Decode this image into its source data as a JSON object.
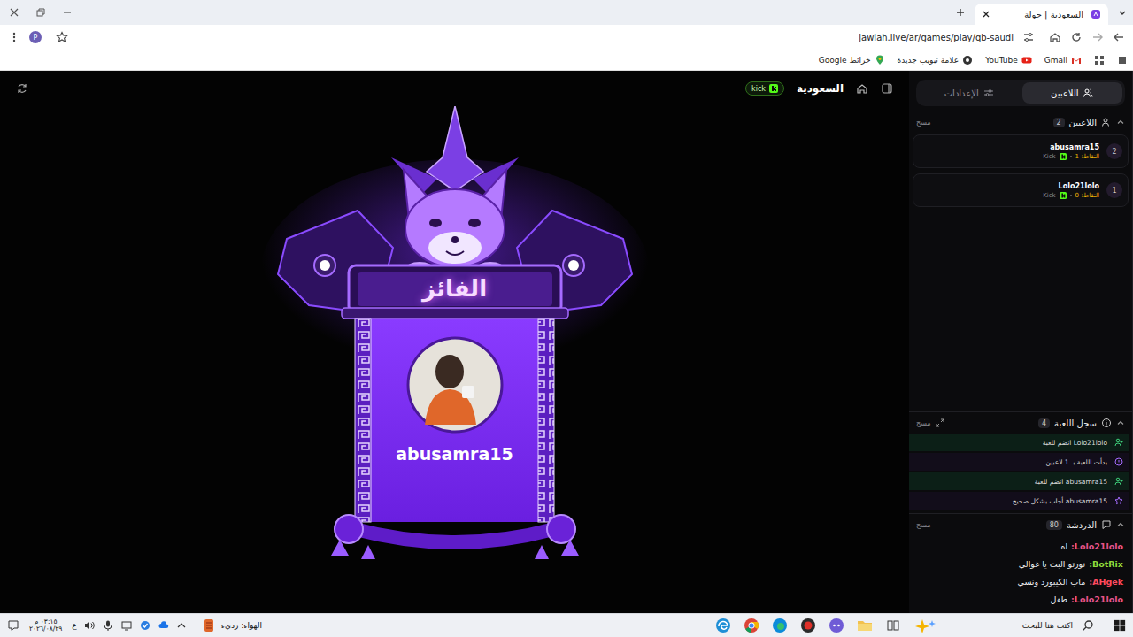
{
  "browser": {
    "tab": {
      "title": "السعودية | جولة",
      "selected": true
    },
    "url": "jawlah.live/ar/games/play/qb-saudi",
    "profile": "P",
    "bookmarks": [
      {
        "label": "Gmail",
        "kind": "gmail"
      },
      {
        "label": "YouTube",
        "kind": "youtube"
      },
      {
        "label": "علامة تبويب جديدة",
        "kind": "newtab"
      },
      {
        "label": "خرائط Google",
        "kind": "maps"
      }
    ]
  },
  "game": {
    "title": "السعودية",
    "platform_badge": "kick",
    "winner_title": "الفائز",
    "winner_name": "abusamra15"
  },
  "sidebar": {
    "tabs": [
      {
        "label": "اللاعبين",
        "selected": true
      },
      {
        "label": "الإعدادات",
        "selected": false
      }
    ],
    "players": {
      "title": "اللاعبين",
      "count": "2",
      "clear": "مسح",
      "items": [
        {
          "rank": "2",
          "name": "abusamra15",
          "platform": "Kick",
          "points": "النقاط: 1"
        },
        {
          "rank": "1",
          "name": "Lolo21lolo",
          "platform": "Kick",
          "points": "النقاط: 0"
        }
      ]
    },
    "log": {
      "title": "سجل اللعبة",
      "count": "4",
      "clear": "مسح",
      "items": [
        {
          "kind": "join",
          "text": "Lolo21lolo انضم للعبة"
        },
        {
          "kind": "start",
          "text": "بدأت اللعبة بـ 1 لاعبين"
        },
        {
          "kind": "join",
          "text": "abusamra15 انضم للعبة"
        },
        {
          "kind": "correct",
          "text": "abusamra15 أجاب بشكل صحيح"
        }
      ]
    },
    "chat": {
      "title": "الدردشة",
      "count": "80",
      "clear": "مسح",
      "messages": [
        {
          "user": "Lolo21lolo:",
          "text": "اه",
          "color": "#e8548a"
        },
        {
          "user": "BotRix:",
          "text": "نورتو البث يا غوالي",
          "color": "#8fdc3a"
        },
        {
          "user": "AHgek:",
          "text": "ماب الكيبورد ونسي",
          "color": "#ff4a5e"
        },
        {
          "user": "Lolo21lolo:",
          "text": "طفل",
          "color": "#e8548a"
        }
      ]
    }
  },
  "taskbar": {
    "search_placeholder": "اكتب هنا للبحث",
    "weather": "الهواء: رديء",
    "language": "ع",
    "time": "٠٣:١٥ م",
    "date": "٢٠٢٦/٠٨/٢٩"
  }
}
